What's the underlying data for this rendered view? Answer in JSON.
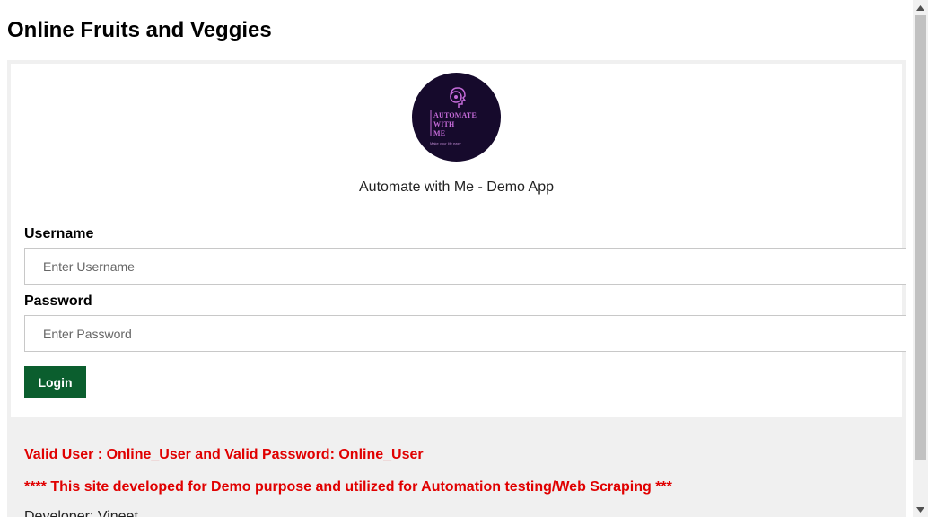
{
  "page": {
    "title": "Online Fruits and Veggies"
  },
  "logo": {
    "line1": "AUTOMATE",
    "line2": "WITH",
    "line3": "ME",
    "tagline": "Make your life easy"
  },
  "app_name": "Automate with Me - Demo App",
  "form": {
    "username_label": "Username",
    "username_placeholder": "Enter Username",
    "username_value": "",
    "password_label": "Password",
    "password_placeholder": "Enter Password",
    "password_value": "",
    "login_label": "Login"
  },
  "info": {
    "credentials": "Valid User : Online_User and Valid Password: Online_User",
    "disclaimer": "**** This site developed for Demo purpose and utilized for Automation testing/Web Scraping ***",
    "developer": "Developer: Vineet"
  },
  "colors": {
    "login_button": "#0b5e2e",
    "notice_text": "#e00000",
    "logo_background": "#160a2c",
    "logo_text": "#c46ad8"
  },
  "icons": {
    "logo_icon": "head-gear-icon",
    "scroll_up": "chevron-up-icon",
    "scroll_down": "chevron-down-icon"
  }
}
